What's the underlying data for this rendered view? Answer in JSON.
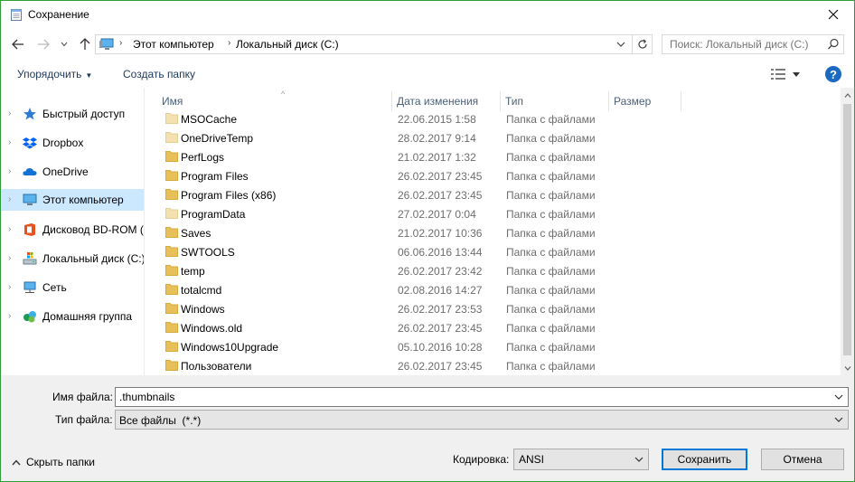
{
  "window": {
    "title": "Сохранение"
  },
  "address": {
    "crumbs": [
      "Этот компьютер",
      "Локальный диск (C:)"
    ]
  },
  "search": {
    "placeholder": "Поиск: Локальный диск (C:)"
  },
  "toolbar": {
    "organize": "Упорядочить",
    "new_folder": "Создать папку"
  },
  "sidebar": {
    "items": [
      {
        "label": "Быстрый доступ",
        "icon": "star-icon"
      },
      {
        "label": "Dropbox",
        "icon": "dropbox-icon"
      },
      {
        "label": "OneDrive",
        "icon": "cloud-icon"
      },
      {
        "label": "Этот компьютер",
        "icon": "computer-icon",
        "selected": true
      },
      {
        "label": "Дисковод BD-ROM (",
        "icon": "office-disc-icon"
      },
      {
        "label": "Локальный диск (C:)",
        "icon": "drive-icon"
      },
      {
        "label": "Сеть",
        "icon": "network-icon"
      },
      {
        "label": "Домашняя группа",
        "icon": "homegroup-icon"
      }
    ]
  },
  "columns": {
    "name": "Имя",
    "date": "Дата изменения",
    "type": "Тип",
    "size": "Размер"
  },
  "files": [
    {
      "name": "MSOCache",
      "date": "22.06.2015 1:58",
      "type": "Папка с файлами",
      "hidden": true
    },
    {
      "name": "OneDriveTemp",
      "date": "28.02.2017 9:14",
      "type": "Папка с файлами",
      "hidden": true
    },
    {
      "name": "PerfLogs",
      "date": "21.02.2017 1:32",
      "type": "Папка с файлами",
      "hidden": false
    },
    {
      "name": "Program Files",
      "date": "26.02.2017 23:45",
      "type": "Папка с файлами",
      "hidden": false
    },
    {
      "name": "Program Files (x86)",
      "date": "26.02.2017 23:45",
      "type": "Папка с файлами",
      "hidden": false
    },
    {
      "name": "ProgramData",
      "date": "27.02.2017 0:04",
      "type": "Папка с файлами",
      "hidden": true
    },
    {
      "name": "Saves",
      "date": "21.02.2017 10:36",
      "type": "Папка с файлами",
      "hidden": false
    },
    {
      "name": "SWTOOLS",
      "date": "06.06.2016 13:44",
      "type": "Папка с файлами",
      "hidden": false
    },
    {
      "name": "temp",
      "date": "26.02.2017 23:42",
      "type": "Папка с файлами",
      "hidden": false
    },
    {
      "name": "totalcmd",
      "date": "02.08.2016 14:27",
      "type": "Папка с файлами",
      "hidden": false
    },
    {
      "name": "Windows",
      "date": "26.02.2017 23:53",
      "type": "Папка с файлами",
      "hidden": false
    },
    {
      "name": "Windows.old",
      "date": "26.02.2017 23:45",
      "type": "Папка с файлами",
      "hidden": false
    },
    {
      "name": "Windows10Upgrade",
      "date": "05.10.2016 10:28",
      "type": "Папка с файлами",
      "hidden": false
    },
    {
      "name": "Пользователи",
      "date": "26.02.2017 23:45",
      "type": "Папка с файлами",
      "hidden": false
    }
  ],
  "form": {
    "filename_label": "Имя файла:",
    "filename_value": ".thumbnails",
    "filetype_label": "Тип файла:",
    "filetype_value": "Все файлы  (*.*)",
    "encoding_label": "Кодировка:",
    "encoding_value": "ANSI",
    "hide_folders": "Скрыть папки",
    "save": "Сохранить",
    "cancel": "Отмена"
  },
  "colors": {
    "window_border": "#2e9e3a",
    "selection": "#cce8ff",
    "accent": "#0078d7",
    "folder": "#e8c05a"
  }
}
